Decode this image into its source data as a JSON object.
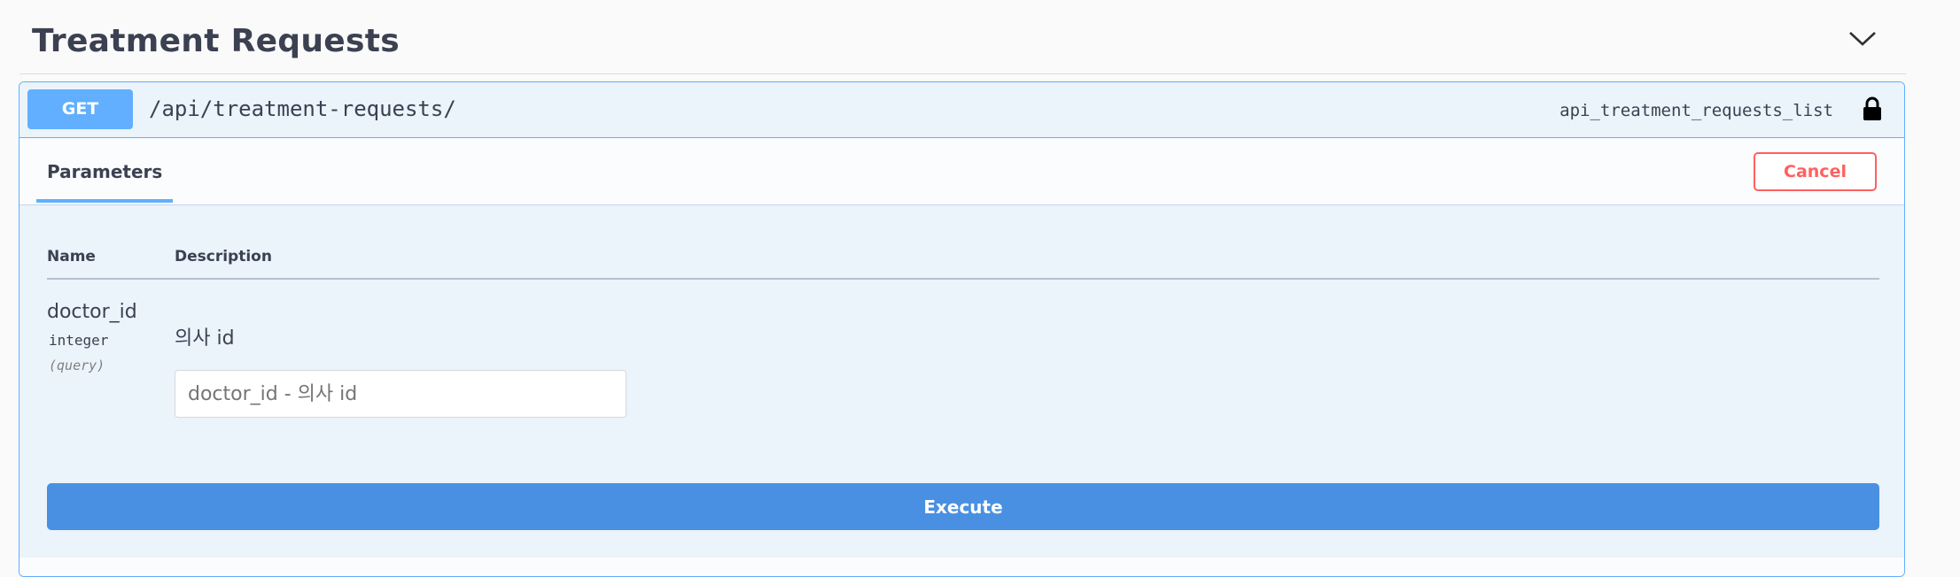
{
  "tag": {
    "title": "Treatment Requests",
    "toggle_icon": "chevron-down-icon"
  },
  "operation": {
    "method": "GET",
    "path": "/api/treatment-requests/",
    "operation_id": "api_treatment_requests_list",
    "lock_icon": "lock-icon",
    "method_color": "#61affe"
  },
  "tabs": {
    "parameters_label": "Parameters",
    "cancel_label": "Cancel"
  },
  "params_table": {
    "headers": [
      "Name",
      "Description"
    ],
    "rows": [
      {
        "name": "doctor_id",
        "type": "integer",
        "in": "(query)",
        "description": "의사 id",
        "placeholder": "doctor_id - 의사 id",
        "value": ""
      }
    ]
  },
  "actions": {
    "execute_label": "Execute",
    "execute_color": "#4990e2",
    "cancel_color": "#ff6060"
  }
}
